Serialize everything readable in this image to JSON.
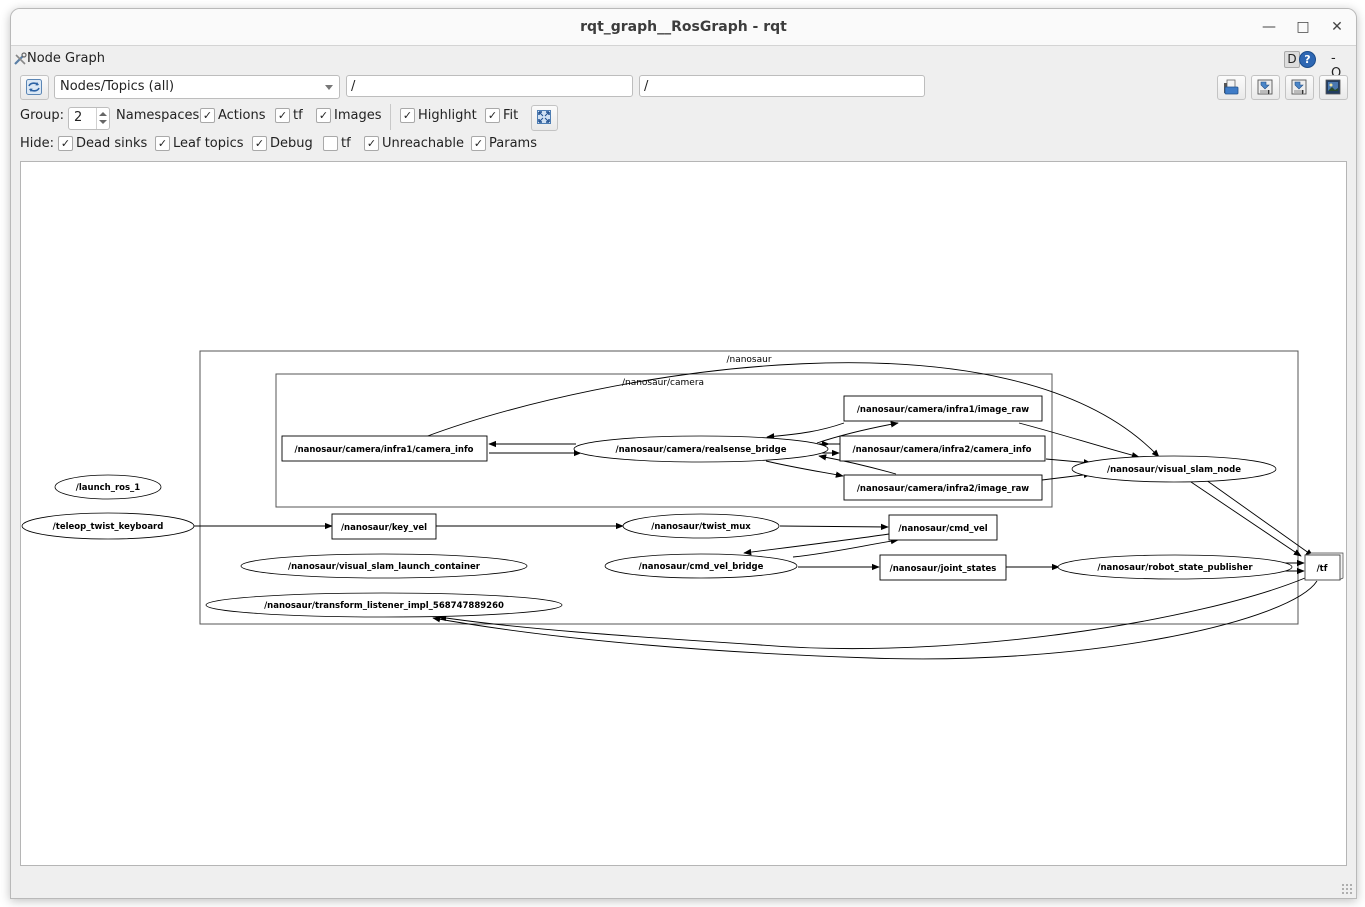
{
  "window": {
    "title": "rqt_graph__RosGraph - rqt",
    "controls": [
      "minimize",
      "maximize",
      "close"
    ]
  },
  "plugin": {
    "title": "Node Graph",
    "d_label": "D",
    "help_label": "?",
    "minus_label": "-",
    "o_label": "O"
  },
  "toolbar": {
    "refresh_icon": "refresh-icon",
    "graph_type": "Nodes/Topics (all)",
    "node_filter": "/",
    "topic_filter": "/",
    "right_buttons": [
      "load-dot-icon",
      "save-dot-icon",
      "save-svg-icon",
      "save-image-icon"
    ]
  },
  "options": {
    "group_label": "Group:",
    "group_value": "2",
    "namespaces_label": "Namespaces",
    "actions": {
      "label": "Actions",
      "checked": true
    },
    "tf": {
      "label": "tf",
      "checked": true
    },
    "images": {
      "label": "Images",
      "checked": true
    },
    "highlight": {
      "label": "Highlight",
      "checked": true
    },
    "fit": {
      "label": "Fit",
      "checked": true
    },
    "fit_button_icon": "fit-in-view-icon"
  },
  "hide": {
    "label": "Hide:",
    "dead_sinks": {
      "label": "Dead sinks",
      "checked": true
    },
    "leaf_topics": {
      "label": "Leaf topics",
      "checked": true
    },
    "debug": {
      "label": "Debug",
      "checked": true
    },
    "tf": {
      "label": "tf",
      "checked": false
    },
    "unreachable": {
      "label": "Unreachable",
      "checked": true
    },
    "params": {
      "label": "Params",
      "checked": true
    }
  },
  "graph": {
    "clusters": [
      {
        "id": "ns_nanosaur",
        "label": "/nanosaur"
      },
      {
        "id": "ns_camera",
        "label": "/nanosaur/camera"
      }
    ],
    "nodes": [
      {
        "id": "launch_ros",
        "label": "/launch_ros_1",
        "kind": "node"
      },
      {
        "id": "teleop",
        "label": "/teleop_twist_keyboard",
        "kind": "node"
      },
      {
        "id": "cam_infra1_info",
        "label": "/nanosaur/camera/infra1/camera_info",
        "kind": "topic"
      },
      {
        "id": "realsense",
        "label": "/nanosaur/camera/realsense_bridge",
        "kind": "node"
      },
      {
        "id": "infra1_raw",
        "label": "/nanosaur/camera/infra1/image_raw",
        "kind": "topic"
      },
      {
        "id": "infra2_info",
        "label": "/nanosaur/camera/infra2/camera_info",
        "kind": "topic"
      },
      {
        "id": "infra2_raw",
        "label": "/nanosaur/camera/infra2/image_raw",
        "kind": "topic"
      },
      {
        "id": "vslam",
        "label": "/nanosaur/visual_slam_node",
        "kind": "node"
      },
      {
        "id": "key_vel",
        "label": "/nanosaur/key_vel",
        "kind": "topic"
      },
      {
        "id": "twist_mux",
        "label": "/nanosaur/twist_mux",
        "kind": "node"
      },
      {
        "id": "cmd_vel",
        "label": "/nanosaur/cmd_vel",
        "kind": "topic"
      },
      {
        "id": "vslam_container",
        "label": "/nanosaur/visual_slam_launch_container",
        "kind": "node"
      },
      {
        "id": "cmd_vel_bridge",
        "label": "/nanosaur/cmd_vel_bridge",
        "kind": "node"
      },
      {
        "id": "joint_states",
        "label": "/nanosaur/joint_states",
        "kind": "topic"
      },
      {
        "id": "rsp",
        "label": "/nanosaur/robot_state_publisher",
        "kind": "node"
      },
      {
        "id": "tf_listener",
        "label": "/nanosaur/transform_listener_impl_568747889260",
        "kind": "node"
      },
      {
        "id": "tf",
        "label": "/tf",
        "kind": "topic"
      }
    ],
    "edges": [
      [
        "realsense",
        "cam_infra1_info"
      ],
      [
        "cam_infra1_info",
        "realsense"
      ],
      [
        "infra1_raw",
        "realsense"
      ],
      [
        "realsense",
        "infra1_raw"
      ],
      [
        "realsense",
        "infra2_info"
      ],
      [
        "infra2_info",
        "realsense"
      ],
      [
        "infra2_raw",
        "realsense"
      ],
      [
        "realsense",
        "infra2_raw"
      ],
      [
        "cam_infra1_info",
        "vslam"
      ],
      [
        "infra1_raw",
        "vslam"
      ],
      [
        "infra2_info",
        "vslam"
      ],
      [
        "infra2_raw",
        "vslam"
      ],
      [
        "vslam",
        "tf"
      ],
      [
        "vslam",
        "tf"
      ],
      [
        "teleop",
        "key_vel"
      ],
      [
        "key_vel",
        "twist_mux"
      ],
      [
        "twist_mux",
        "cmd_vel"
      ],
      [
        "cmd_vel",
        "cmd_vel_bridge"
      ],
      [
        "cmd_vel_bridge",
        "cmd_vel"
      ],
      [
        "cmd_vel_bridge",
        "joint_states"
      ],
      [
        "joint_states",
        "rsp"
      ],
      [
        "rsp",
        "tf"
      ],
      [
        "rsp",
        "tf"
      ],
      [
        "tf",
        "tf_listener"
      ],
      [
        "tf",
        "tf_listener"
      ]
    ]
  }
}
